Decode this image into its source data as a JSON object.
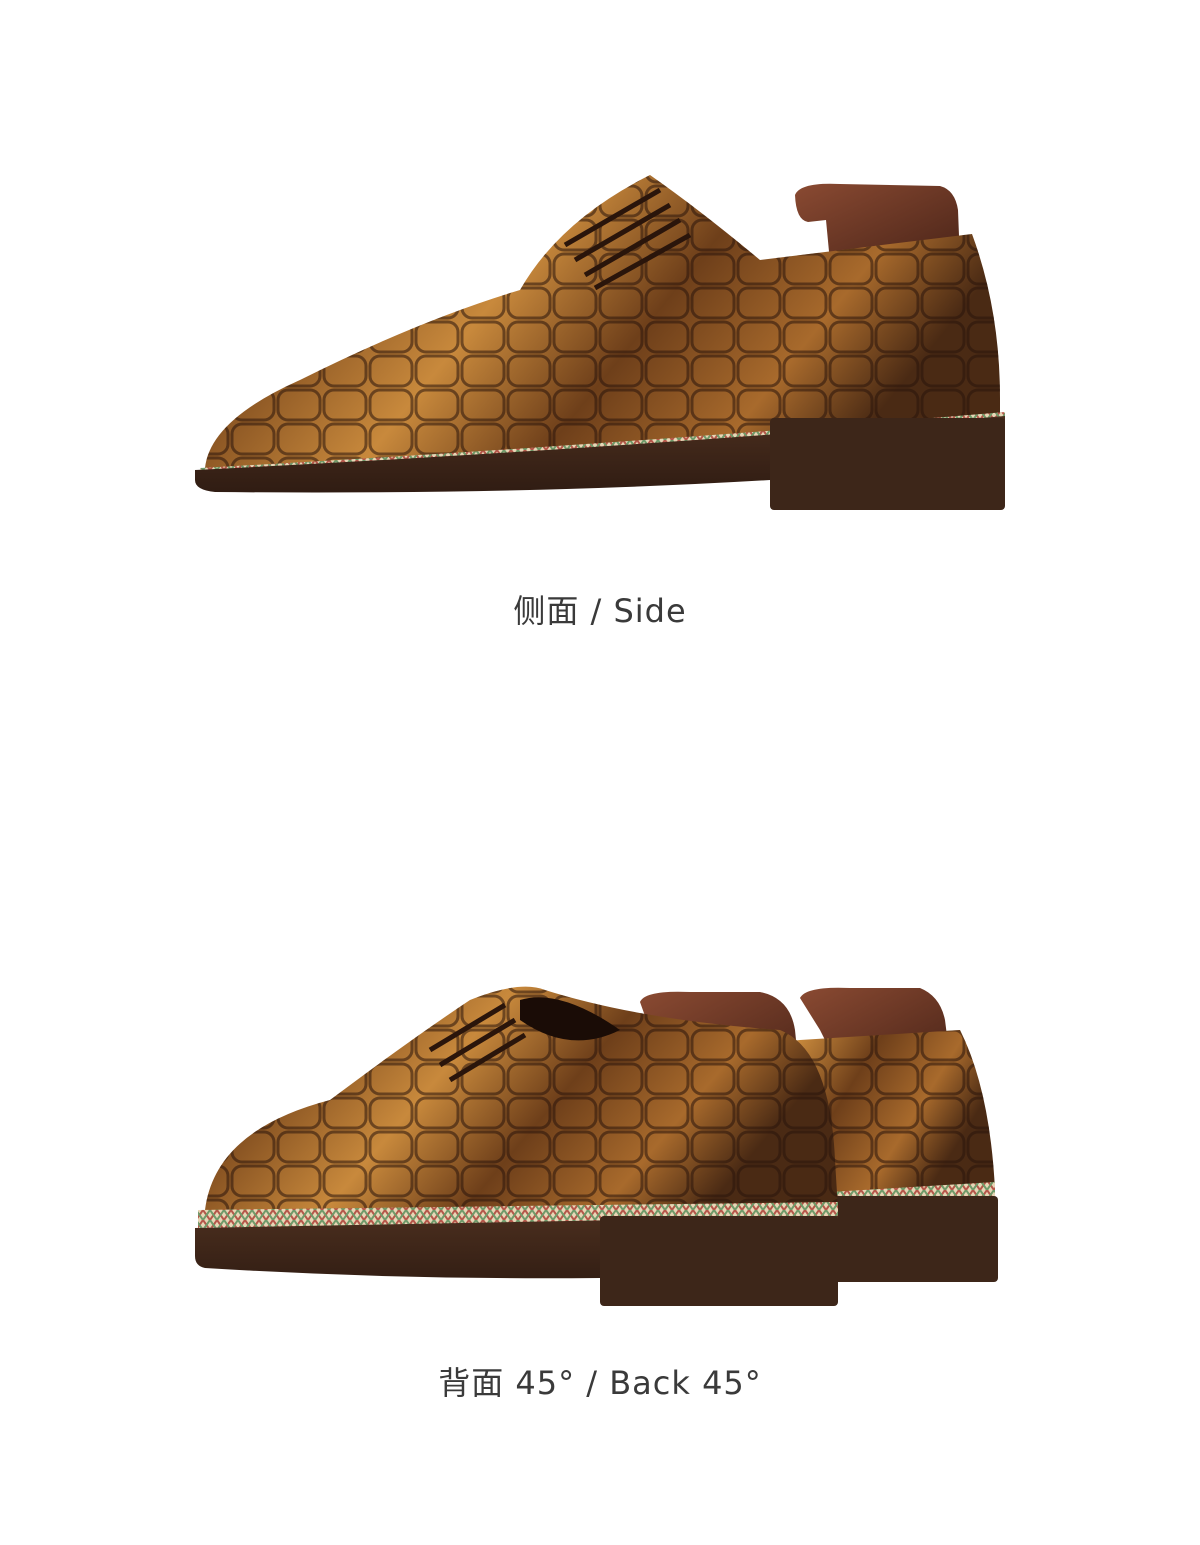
{
  "views": [
    {
      "caption": "侧面 / Side"
    },
    {
      "caption": "背面 45° / Back 45°"
    }
  ],
  "colors": {
    "background": "#ffffff",
    "caption_text": "#3a3a3a",
    "leather_dark": "#3b1f10",
    "leather_mid": "#7a4a1e",
    "leather_light": "#c8893c",
    "sole": "#3a2418",
    "shoe_tree": "#6b3826"
  }
}
